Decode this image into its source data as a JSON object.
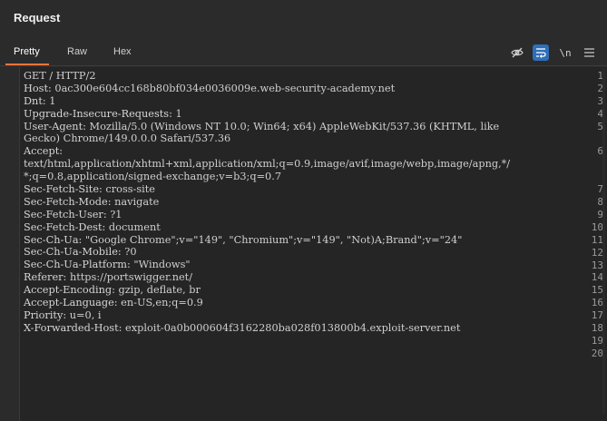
{
  "panel": {
    "title": "Request"
  },
  "tabs": [
    {
      "label": "Pretty",
      "active": true
    },
    {
      "label": "Raw",
      "active": false
    },
    {
      "label": "Hex",
      "active": false
    }
  ],
  "toolbar": {
    "hide_icon": "eye-off-icon",
    "wrap_icon": "wrap-icon",
    "newline_label": "\\n",
    "menu_icon": "hamburger-menu-icon"
  },
  "editor": {
    "line_numbers": [
      "1",
      "2",
      "3",
      "4",
      "5",
      "",
      "6",
      "",
      "",
      "7",
      "8",
      "9",
      "10",
      "11",
      "12",
      "13",
      "14",
      "15",
      "16",
      "17",
      "18",
      "19",
      "20"
    ],
    "lines": [
      [
        "",
        "GET / HTTP/2"
      ],
      [
        "Host:",
        " 0ac300e604cc168b80bf034e0036009e.web-security-academy.net"
      ],
      [
        "Dnt:",
        " 1"
      ],
      [
        "Upgrade-Insecure-Requests:",
        " 1"
      ],
      [
        "User-Agent:",
        " Mozilla/5.0 (Windows NT 10.0; Win64; x64) AppleWebKit/537.36 (KHTML, like"
      ],
      [
        "",
        "Gecko) Chrome/149.0.0.0 Safari/537.36"
      ],
      [
        "Accept:",
        ""
      ],
      [
        "",
        "text/html,application/xhtml+xml,application/xml;q=0.9,image/avif,image/webp,image/apng,*/"
      ],
      [
        "",
        "*;q=0.8,application/signed-exchange;v=b3;q=0.7"
      ],
      [
        "Sec-Fetch-Site:",
        " cross-site"
      ],
      [
        "Sec-Fetch-Mode:",
        " navigate"
      ],
      [
        "Sec-Fetch-User:",
        " ?1"
      ],
      [
        "Sec-Fetch-Dest:",
        " document"
      ],
      [
        "Sec-Ch-Ua:",
        " \"Google Chrome\";v=\"149\", \"Chromium\";v=\"149\", \"Not)A;Brand\";v=\"24\""
      ],
      [
        "Sec-Ch-Ua-Mobile:",
        " ?0"
      ],
      [
        "Sec-Ch-Ua-Platform:",
        " \"Windows\""
      ],
      [
        "Referer:",
        " https://portswigger.net/"
      ],
      [
        "Accept-Encoding:",
        " gzip, deflate, br"
      ],
      [
        "Accept-Language:",
        " en-US,en;q=0.9"
      ],
      [
        "Priority:",
        " u=0, i"
      ],
      [
        "X-Forwarded-Host:",
        " exploit-0a0b000604f3162280ba028f013800b4.exploit-server.net"
      ],
      [
        "",
        ""
      ],
      [
        "",
        ""
      ]
    ]
  },
  "colors": {
    "accent": "#e8743b",
    "active_tool": "#2f6eb8",
    "background": "#2b2b2b"
  }
}
